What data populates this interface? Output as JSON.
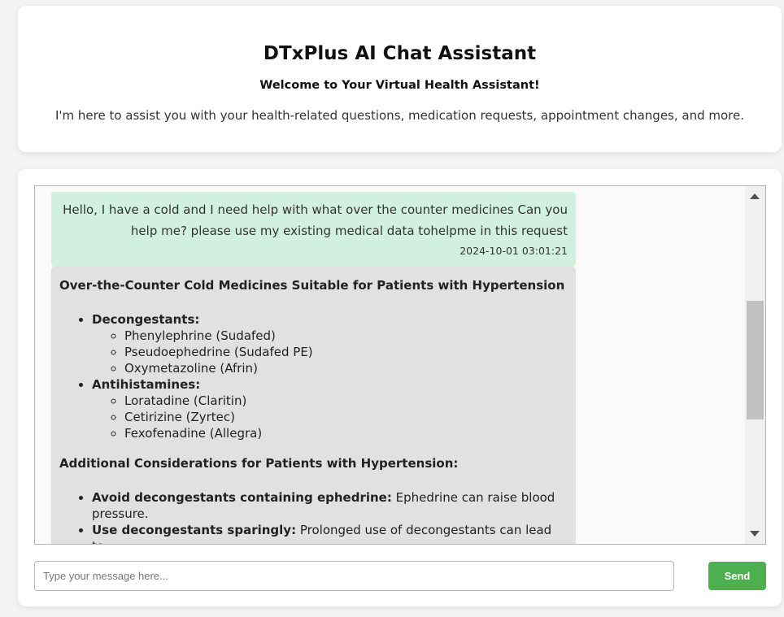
{
  "header": {
    "title": "DTxPlus AI Chat Assistant",
    "subtitle": "Welcome to Your Virtual Health Assistant!",
    "description": "I'm here to assist you with your health-related questions, medication requests, appointment changes, and more."
  },
  "chat": {
    "user_message": {
      "text": "Hello, I have a cold and I need help with what over the counter medicines Can you help me? please use my existing medical data tohelpme in this request",
      "timestamp": "2024-10-01 03:01:21"
    },
    "bot_message": {
      "heading": "Over-the-Counter Cold Medicines Suitable for Patients with Hypertension",
      "groups": [
        {
          "label": "Decongestants:",
          "items": [
            "Phenylephrine (Sudafed)",
            "Pseudoephedrine (Sudafed PE)",
            "Oxymetazoline (Afrin)"
          ]
        },
        {
          "label": "Antihistamines:",
          "items": [
            "Loratadine (Claritin)",
            "Cetirizine (Zyrtec)",
            "Fexofenadine (Allegra)"
          ]
        }
      ],
      "heading2": "Additional Considerations for Patients with Hypertension:",
      "considerations": [
        {
          "label": "Avoid decongestants containing ephedrine:",
          "text": " Ephedrine can raise blood pressure."
        },
        {
          "label": "Use decongestants sparingly:",
          "text": " Prolonged use of decongestants can lead to"
        }
      ]
    }
  },
  "composer": {
    "placeholder": "Type your message here...",
    "send_label": "Send"
  },
  "colors": {
    "user_bubble": "#d1f0df",
    "bot_bubble": "#e1e1e1",
    "send_button": "#4caf50"
  }
}
